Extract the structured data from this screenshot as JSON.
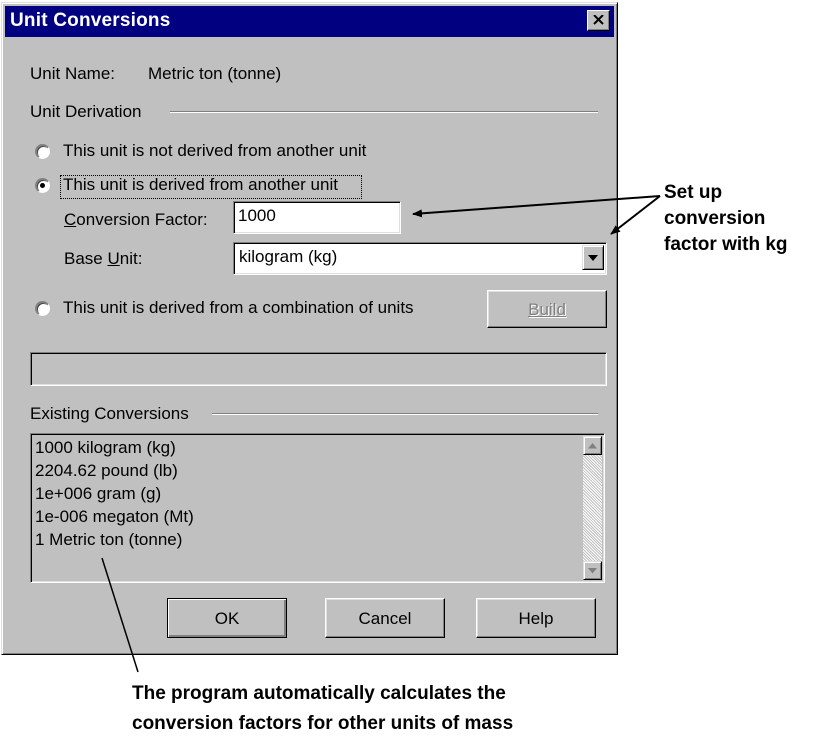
{
  "dialog": {
    "title": "Unit Conversions",
    "unit_name_label": "Unit Name:",
    "unit_name_value": "Metric ton (tonne)",
    "derivation_group": "Unit Derivation",
    "radio_not_derived": "This unit is not derived from another unit",
    "radio_derived": "This unit is derived from another unit",
    "conversion_factor_label_pre": "",
    "conversion_factor_label_acc": "C",
    "conversion_factor_label_post": "onversion Factor:",
    "conversion_factor_value": "1000",
    "base_unit_label_pre": "Base ",
    "base_unit_label_acc": "U",
    "base_unit_label_post": "nit:",
    "base_unit_value": "kilogram (kg)",
    "radio_combination": "This unit is derived from a combination of units",
    "build_button_acc": "B",
    "build_button_post": "uild",
    "combination_field_value": "",
    "existing_group": "Existing Conversions",
    "existing_conversions": [
      "1000 kilogram (kg)",
      "2204.62 pound (lb)",
      "1e+006 gram (g)",
      "1e-006 megaton (Mt)",
      "1 Metric ton (tonne)"
    ],
    "ok_button": "OK",
    "cancel_button": "Cancel",
    "help_button": "Help",
    "selected_radio": "derived"
  },
  "annotations": {
    "right_callout": [
      "Set up",
      "conversion",
      "factor with kg"
    ],
    "bottom_callout": [
      "The program automatically calculates the",
      "conversion factors for other units of mass"
    ]
  },
  "colors": {
    "titlebar": "#000080",
    "dialog_face": "#c0c0c0"
  }
}
